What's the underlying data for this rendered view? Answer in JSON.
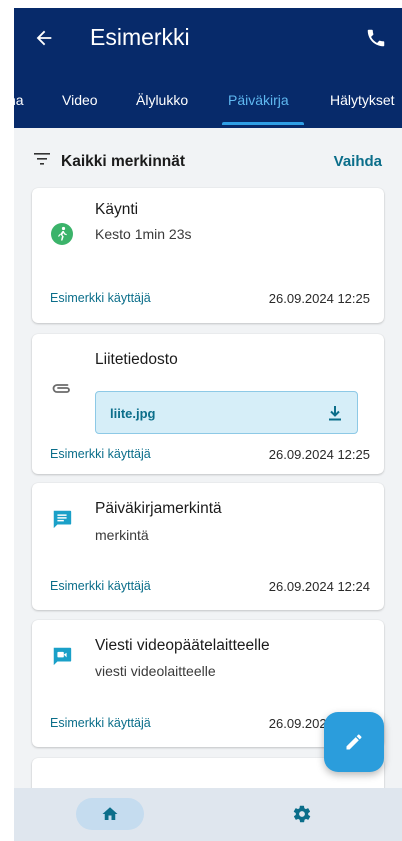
{
  "app": {
    "title": "Esimerkki",
    "back_icon": "arrow-left-icon",
    "call_icon": "phone-icon"
  },
  "tabs": [
    {
      "label": "na",
      "active": false
    },
    {
      "label": "Video",
      "active": false
    },
    {
      "label": "Älylukko",
      "active": false
    },
    {
      "label": "Päiväkirja",
      "active": true
    },
    {
      "label": "Hälytykset",
      "active": false
    }
  ],
  "feed": {
    "filter_label": "Kaikki merkinnät",
    "change_label": "Vaihda"
  },
  "entries": [
    {
      "type": "visit",
      "icon": "walking-icon",
      "title": "Käynti",
      "subtitle": "Kesto 1min 23s",
      "author": "Esimerkki käyttäjä",
      "date": "26.09.2024 12:25"
    },
    {
      "type": "attachment",
      "icon": "paperclip-icon",
      "title": "Liitetiedosto",
      "file_name": "liite.jpg",
      "author": "Esimerkki käyttäjä",
      "date": "26.09.2024 12:25"
    },
    {
      "type": "diary",
      "icon": "message-icon",
      "title": "Päiväkirjamerkintä",
      "subtitle": "merkintä",
      "author": "Esimerkki käyttäjä",
      "date": "26.09.2024 12:24"
    },
    {
      "type": "video-message",
      "icon": "video-message-icon",
      "title": "Viesti videopäätelaitteelle",
      "subtitle": "viesti videolaitteelle",
      "author": "Esimerkki käyttäjä",
      "date": "26.09.2024 12:24"
    }
  ],
  "colors": {
    "app_bar": "#072a6a",
    "active_tab": "#5fb8f0",
    "accent": "#2b9ddc",
    "link": "#0b6e8a",
    "visit_green": "#3bb36a",
    "card_icon_teal": "#1aa0c8"
  },
  "fab_icon": "pencil-icon",
  "bottom_nav": {
    "home_icon": "home-icon",
    "settings_icon": "gear-icon"
  }
}
